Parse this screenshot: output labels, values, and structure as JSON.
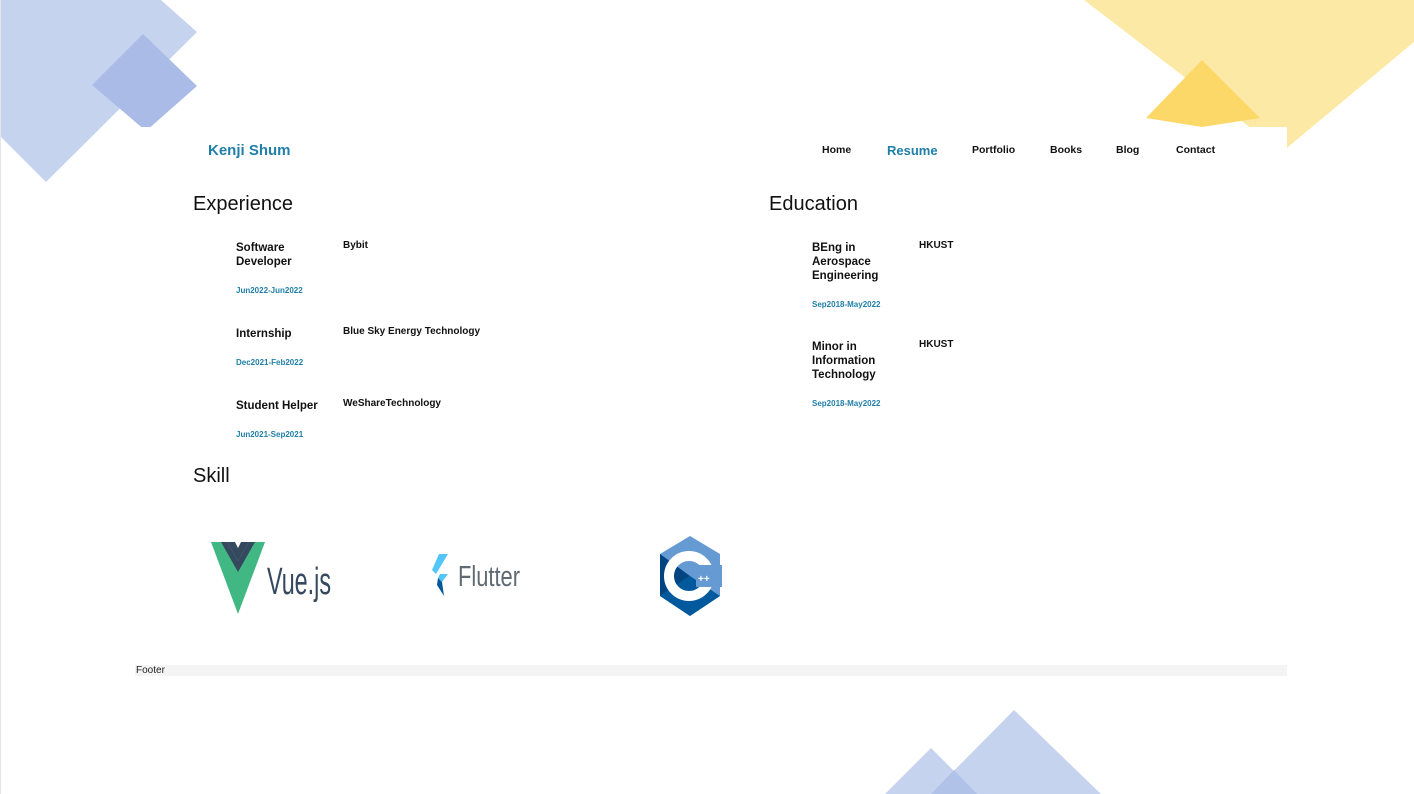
{
  "header": {
    "brand": "Kenji Shum",
    "nav": [
      {
        "label": "Home"
      },
      {
        "label": "Resume"
      },
      {
        "label": "Portfolio"
      },
      {
        "label": "Books"
      },
      {
        "label": "Blog"
      },
      {
        "label": "Contact"
      }
    ],
    "active_nav": "Resume"
  },
  "experience": {
    "title": "Experience",
    "items": [
      {
        "role": "Software Developer",
        "org": "Bybit",
        "date": "Jun2022-Jun2022"
      },
      {
        "role": "Internship",
        "org": "Blue Sky Energy Technology",
        "date": "Dec2021-Feb2022"
      },
      {
        "role": "Student Helper",
        "org": "WeShareTechnology",
        "date": "Jun2021-Sep2021"
      }
    ]
  },
  "education": {
    "title": "Education",
    "items": [
      {
        "role": "BEng in Aerospace Engineering",
        "org": "HKUST",
        "date": "Sep2018-May2022"
      },
      {
        "role": "Minor in Information Technology",
        "org": "HKUST",
        "date": "Sep2018-May2022"
      }
    ]
  },
  "skill": {
    "title": "Skill",
    "logos": [
      {
        "name": "Vue.js",
        "icon": "vuejs-logo"
      },
      {
        "name": "Flutter",
        "icon": "flutter-logo"
      },
      {
        "name": "C++",
        "icon": "cpp-logo"
      }
    ]
  },
  "footer": {
    "text": "Footer"
  },
  "colors": {
    "accent": "#1f7fa8",
    "deco_blue": "#c6d3ee",
    "deco_yellow": "#fde9a6",
    "vue_green": "#41b883",
    "vue_dark": "#35495e",
    "flutter_light": "#54c5f8",
    "flutter_dark": "#01579b",
    "cpp_blue": "#00599c"
  }
}
